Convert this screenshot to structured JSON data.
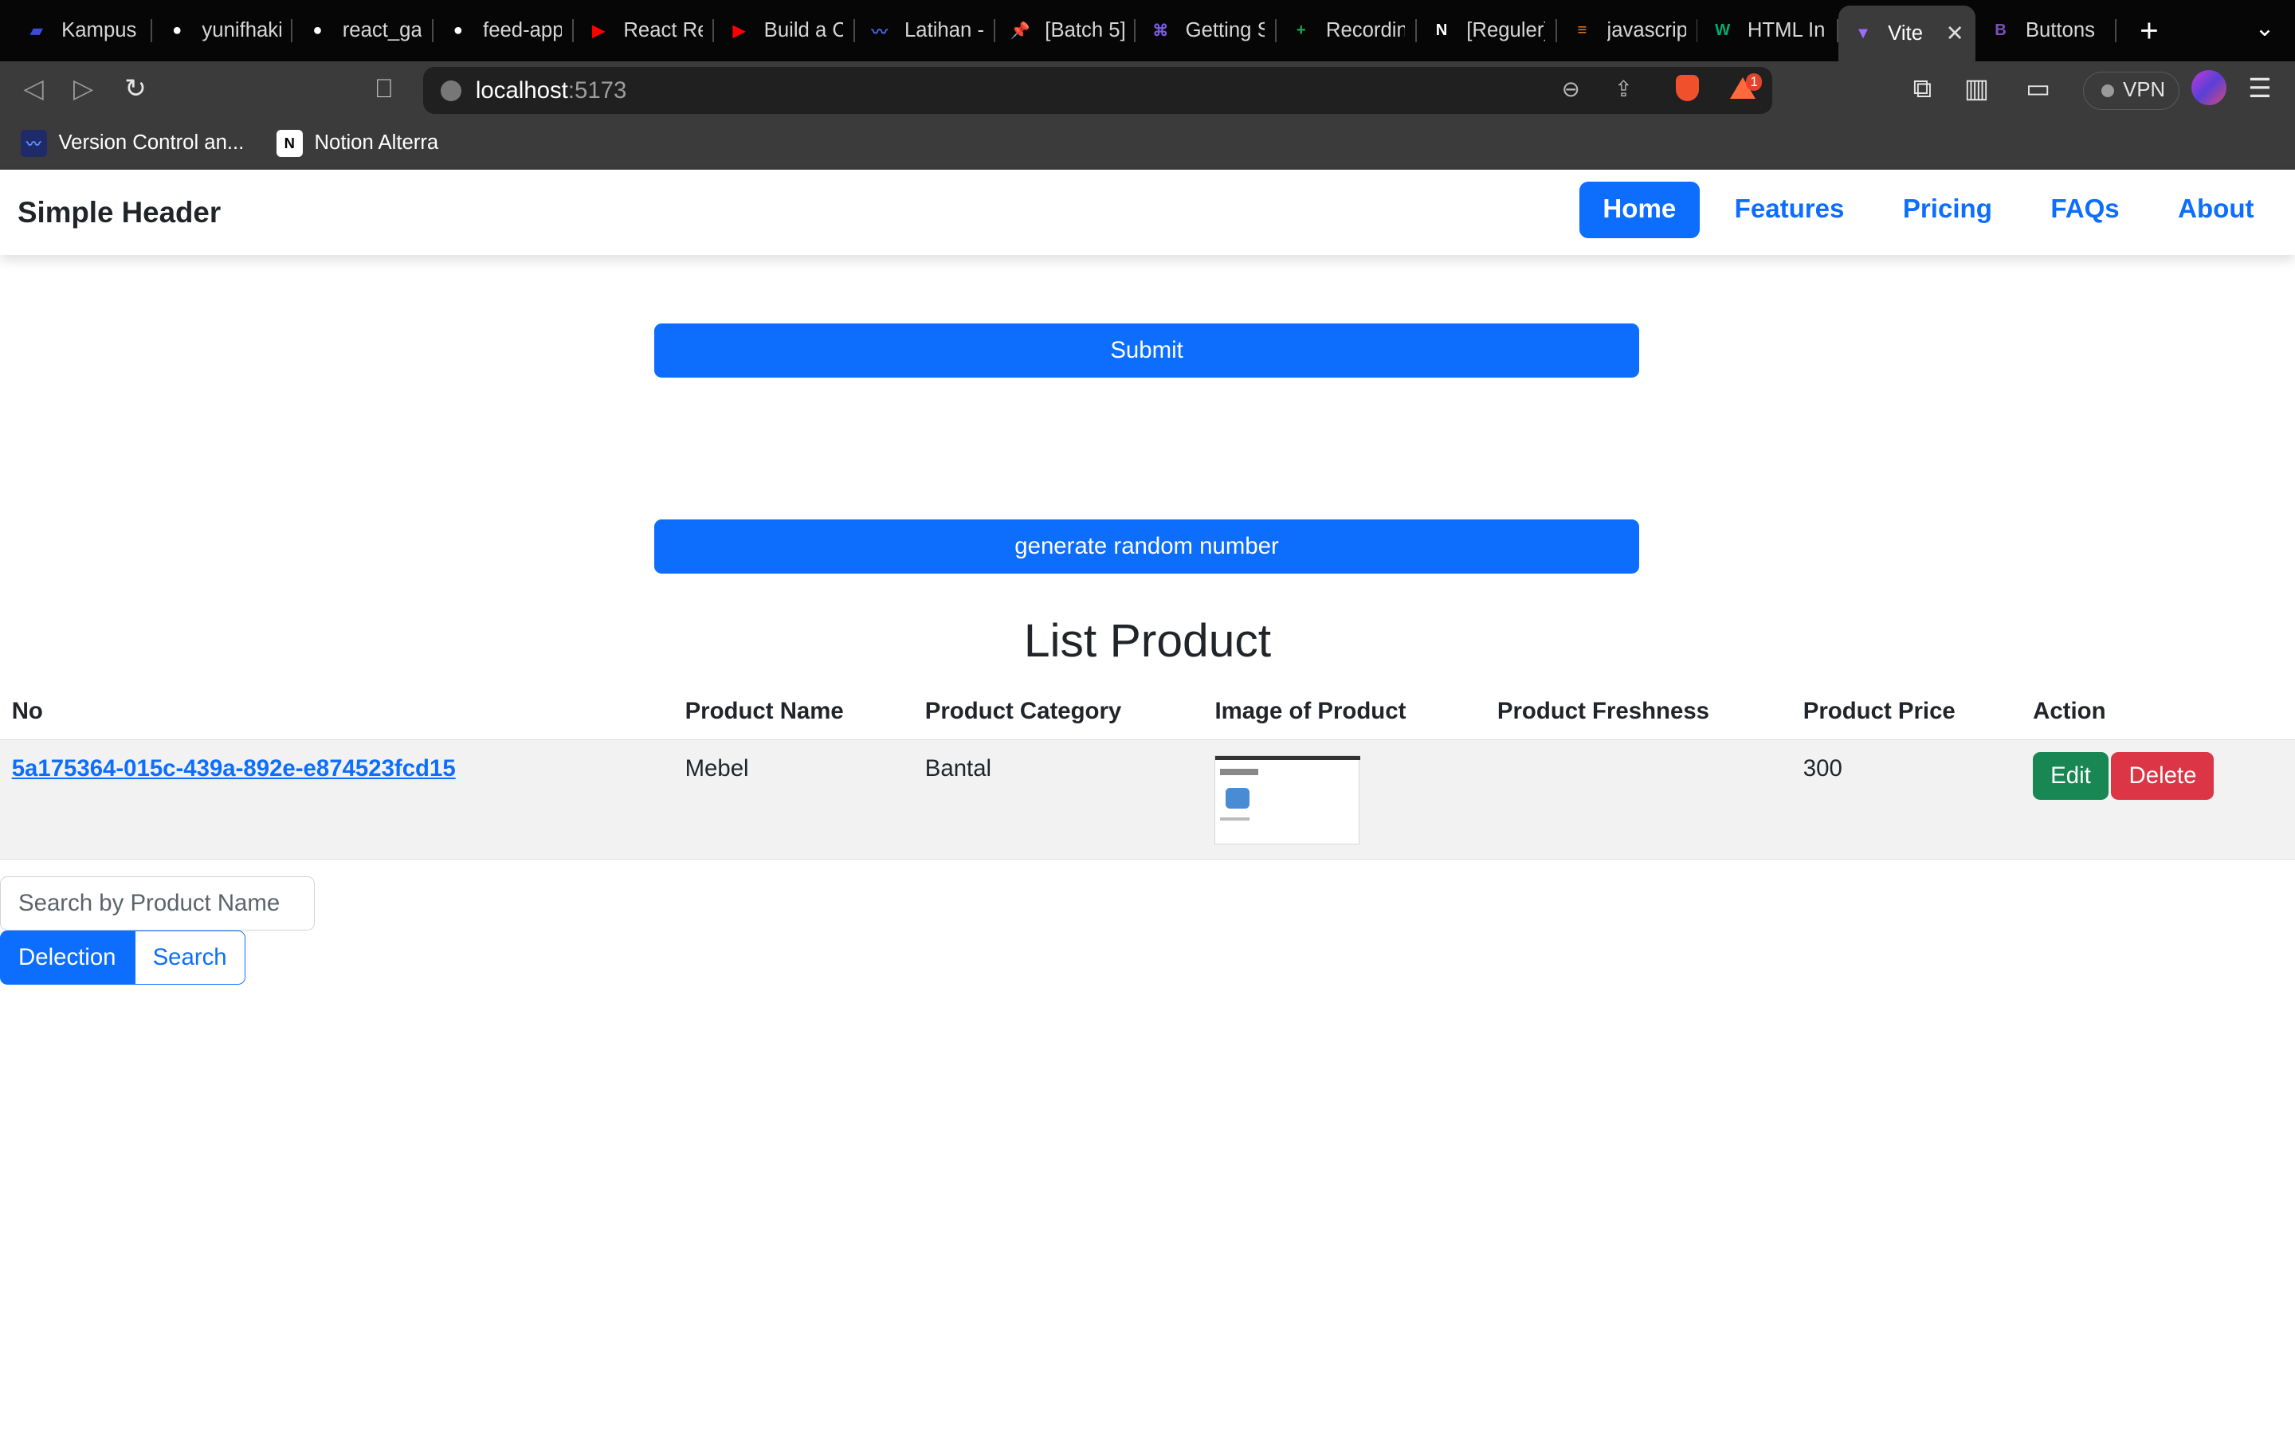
{
  "browser": {
    "tabs": [
      {
        "title": "Kampus M",
        "icon": "kampus-merdeka-icon",
        "color": "#3b4bd6"
      },
      {
        "title": "yunifhakim",
        "icon": "github-icon",
        "color": "#ffffff"
      },
      {
        "title": "react_gallery",
        "icon": "github-icon",
        "color": "#ffffff"
      },
      {
        "title": "feed-app",
        "icon": "github-icon",
        "color": "#ffffff"
      },
      {
        "title": "React Re",
        "icon": "youtube-icon",
        "color": "#ff0000"
      },
      {
        "title": "Build a C",
        "icon": "youtube-icon",
        "color": "#ff0000"
      },
      {
        "title": "Latihan -",
        "icon": "alterra-icon",
        "color": "#4a63e0"
      },
      {
        "title": "[Batch 5]",
        "icon": "pin-icon",
        "color": "#e23b3b"
      },
      {
        "title": "Getting S",
        "icon": "react-router-icon",
        "color": "#7a5be0"
      },
      {
        "title": "Recording",
        "icon": "sheets-plus-icon",
        "color": "#23a454"
      },
      {
        "title": "[Reguler]",
        "icon": "notion-icon",
        "color": "#ffffff"
      },
      {
        "title": "javascrip",
        "icon": "stackoverflow-icon",
        "color": "#f48024"
      },
      {
        "title": "HTML Inp",
        "icon": "w3schools-icon",
        "color": "#04aa6d"
      },
      {
        "title": "Vite",
        "icon": "vite-icon",
        "color": "#9d6bff",
        "active": true
      },
      {
        "title": "Buttons",
        "icon": "bootstrap-icon",
        "color": "#7952b3"
      }
    ],
    "new_tab_glyph": "+",
    "close_glyph": "✕",
    "url_host": "localhost",
    "url_port": ":5173",
    "vpn_label": "VPN",
    "rewards_badge": "1",
    "bookmarks": [
      {
        "label": "Version Control an...",
        "icon": "alterra-icon"
      },
      {
        "label": "Notion Alterra",
        "icon": "notion-icon"
      }
    ]
  },
  "header": {
    "brand": "Simple Header",
    "nav": [
      {
        "label": "Home",
        "active": true
      },
      {
        "label": "Features"
      },
      {
        "label": "Pricing"
      },
      {
        "label": "FAQs"
      },
      {
        "label": "About"
      }
    ]
  },
  "form": {
    "submit_label": "Submit",
    "random_label": "generate random number"
  },
  "list": {
    "title": "List Product",
    "columns": [
      "No",
      "Product Name",
      "Product Category",
      "Image of Product",
      "Product Freshness",
      "Product Price",
      "Action"
    ],
    "rows": [
      {
        "id": "5a175364-015c-439a-892e-e874523fcd15",
        "name": "Mebel",
        "category": "Bantal",
        "freshness": "",
        "price": "300",
        "edit_label": "Edit",
        "delete_label": "Delete"
      }
    ]
  },
  "search": {
    "placeholder": "Search by Product Name",
    "delection_label": "Delection",
    "search_label": "Search"
  }
}
